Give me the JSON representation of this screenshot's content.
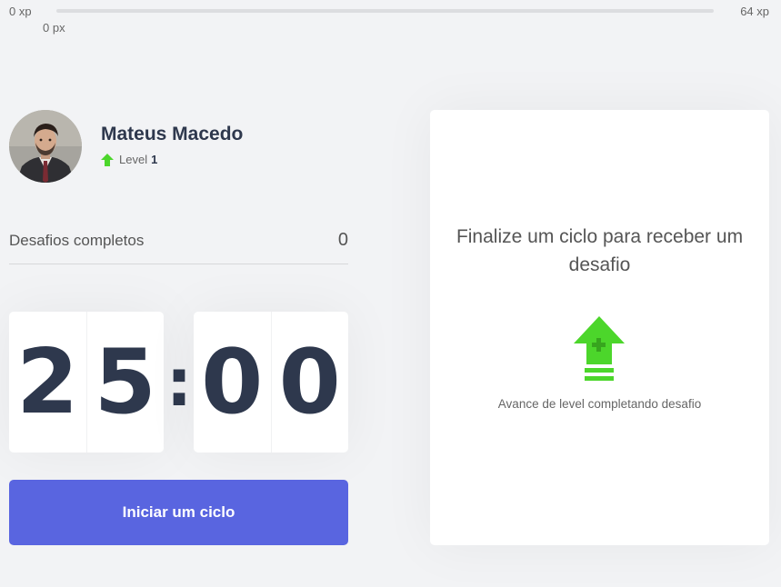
{
  "xp_bar": {
    "min_label": "0 xp",
    "max_label": "64 xp",
    "current_label": "0 px",
    "progress_fraction": 0.0,
    "track_color": "#dcdde0",
    "fill_color": "#4cd62b"
  },
  "profile": {
    "name": "Mateus Macedo",
    "level_label": "Level",
    "level_value": "1",
    "level_icon": "level-up-arrow-icon",
    "avatar": "profile-photo"
  },
  "challenges": {
    "label": "Desafios completos",
    "count": "0"
  },
  "countdown": {
    "minute_left": "2",
    "minute_right": "5",
    "separator": ":",
    "second_left": "0",
    "second_right": "0"
  },
  "start_button": {
    "label": "Iniciar um ciclo",
    "color": "#5965e0"
  },
  "challenge_box": {
    "title": "Finalize um ciclo para receber um desafio",
    "hint": "Avance de level completando desafio",
    "icon": "level-up-icon",
    "accent_color": "#4cd62b"
  }
}
